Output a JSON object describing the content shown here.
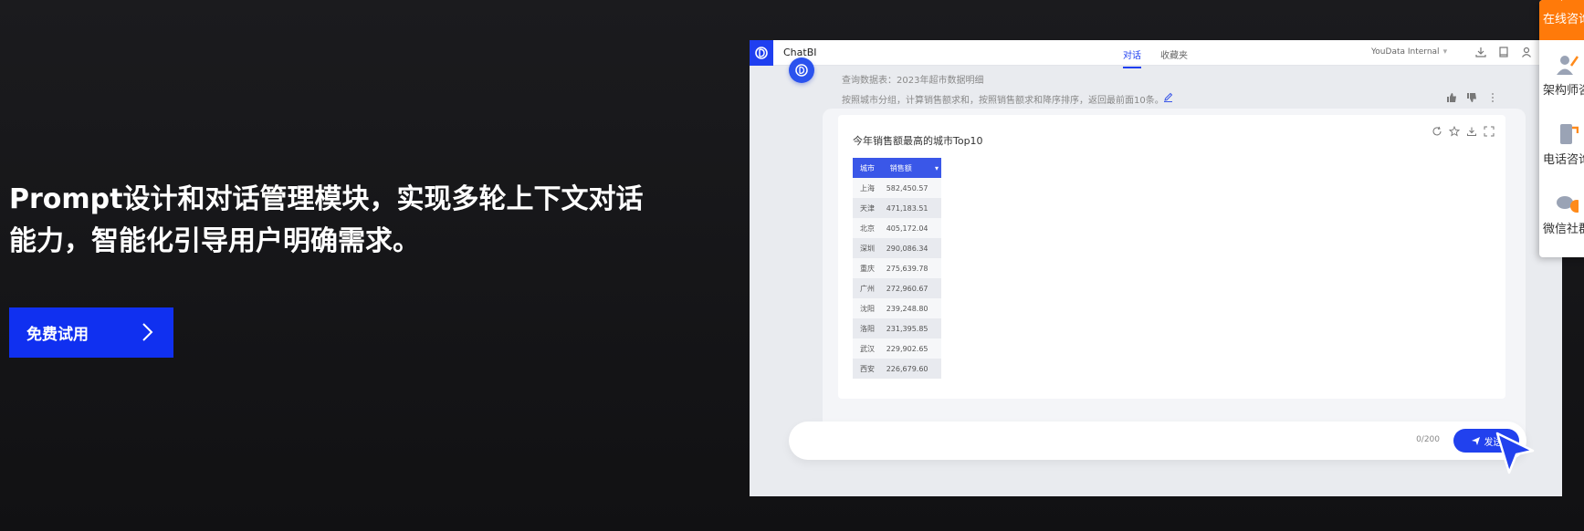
{
  "hero": {
    "title_line1": "Prompt设计和对话管理模块，实现多轮上下文对话",
    "title_line2": "能力，智能化引导用户明确需求。",
    "cta_label": "免费试用"
  },
  "app": {
    "name": "ChatBI",
    "tabs": [
      {
        "label": "对话",
        "active": true
      },
      {
        "label": "收藏夹",
        "active": false
      }
    ],
    "org_name": "YouData Internal"
  },
  "message": {
    "query_info": "查询数据表：2023年超市数据明细",
    "query_desc": "按照城市分组，计算销售额求和，按照销售额求和降序排序，返回最前面10条。"
  },
  "chart_data": {
    "type": "table",
    "title": "今年销售额最高的城市Top10",
    "columns": [
      "城市",
      "销售额"
    ],
    "rows": [
      [
        "上海",
        "582,450.57"
      ],
      [
        "天津",
        "471,183.51"
      ],
      [
        "北京",
        "405,172.04"
      ],
      [
        "深圳",
        "290,086.34"
      ],
      [
        "重庆",
        "275,639.78"
      ],
      [
        "广州",
        "272,960.67"
      ],
      [
        "沈阳",
        "239,248.80"
      ],
      [
        "洛阳",
        "231,395.85"
      ],
      [
        "武汉",
        "229,902.65"
      ],
      [
        "西安",
        "226,679.60"
      ]
    ]
  },
  "input": {
    "char_count": "0/200",
    "send_label": "发送"
  },
  "contact": {
    "items": [
      {
        "label": "在线咨询",
        "icon": "chat-bubble-icon",
        "active": true
      },
      {
        "label": "架构师咨询",
        "icon": "architect-icon",
        "active": false
      },
      {
        "label": "电话咨询",
        "icon": "phone-icon",
        "active": false
      },
      {
        "label": "微信社群",
        "icon": "wechat-icon",
        "active": false
      }
    ]
  },
  "colors": {
    "accent": "#1030f0",
    "table_header": "#3a57e8",
    "contact_active": "#ff7a0a"
  }
}
